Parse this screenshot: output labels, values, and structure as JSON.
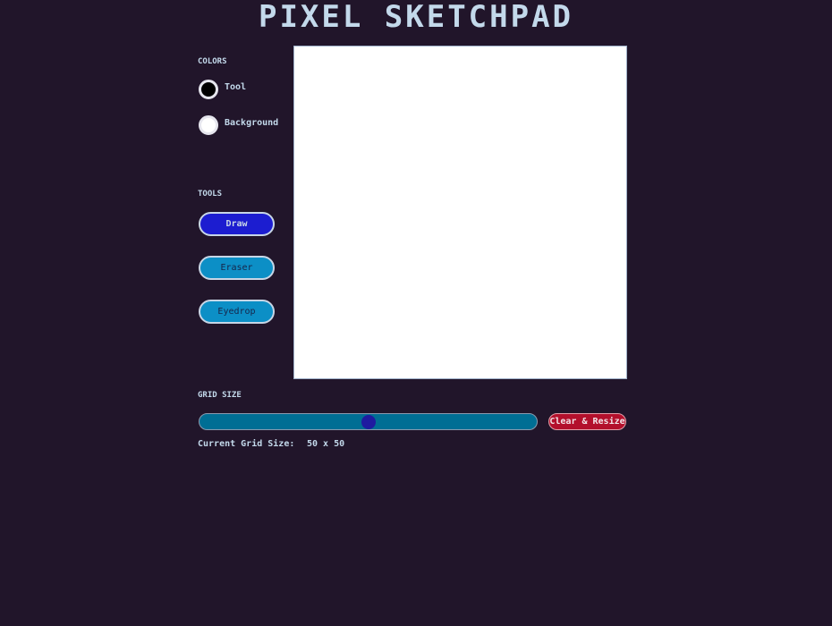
{
  "header": {
    "title": "PIXEL SKETCHPAD"
  },
  "colors": {
    "heading": "COLORS",
    "tool_label": "Tool",
    "tool_color": "#000000",
    "background_label": "Background",
    "background_color": "#ffffff"
  },
  "tools": {
    "heading": "TOOLS",
    "items": [
      {
        "label": "Draw",
        "active": true
      },
      {
        "label": "Eraser",
        "active": false
      },
      {
        "label": "Eyedrop",
        "active": false
      }
    ]
  },
  "grid": {
    "heading": "GRID SIZE",
    "slider_fraction": 0.5,
    "clear_label": "Clear & Resize",
    "current_label": "Current Grid Size:",
    "current_value": "50 x 50"
  }
}
